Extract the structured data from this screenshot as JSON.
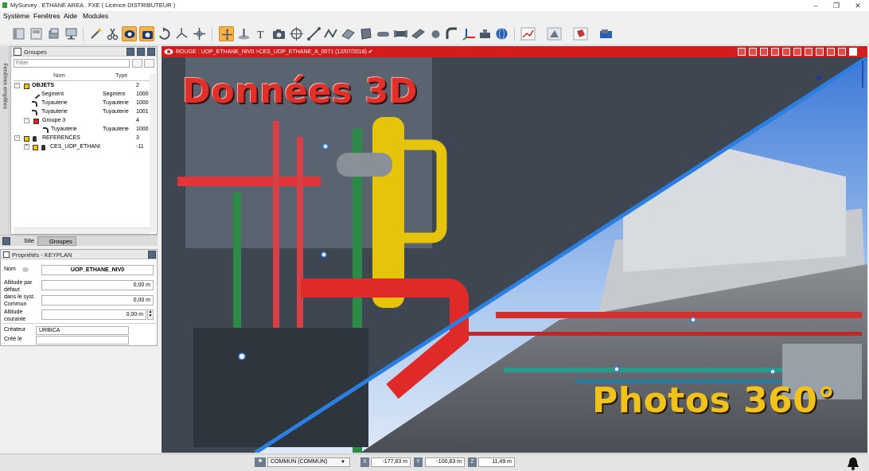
{
  "window": {
    "title": "MySurvey . ETHANE AREA . FXE ( Licence DISTRIBUTEUR )",
    "minimize": "–",
    "maximize": "❐",
    "close": "✕"
  },
  "menu": {
    "items": [
      {
        "label": "Système"
      },
      {
        "label": "Fenêtres"
      },
      {
        "label": "Aide"
      },
      {
        "label": "Modules"
      }
    ]
  },
  "sidebar_tab": {
    "label": "Fenêtres empilées"
  },
  "groups_panel": {
    "title": "Groupes",
    "filter_placeholder": "Filter",
    "columns": {
      "name": "Nom",
      "type": "Type"
    },
    "rows": [
      {
        "name": "OBJETS",
        "type": "",
        "value": "2"
      },
      {
        "name": "Segment",
        "type": "Segment",
        "value": "1000"
      },
      {
        "name": "Tuyauterie",
        "type": "Tuyauterie",
        "value": "1000"
      },
      {
        "name": "Tuyauterie",
        "type": "Tuyauterie",
        "value": "1001"
      },
      {
        "name": "Groupe 3",
        "type": "",
        "value": "4"
      },
      {
        "name": "Tuyauterie",
        "type": "Tuyauterie",
        "value": "1000"
      },
      {
        "name": "REFERENCES",
        "type": "",
        "value": "3"
      },
      {
        "name": "CES_UOP_ETHANI",
        "type": "",
        "value": "-11"
      }
    ],
    "tabs": [
      {
        "label": "Site"
      },
      {
        "label": "Groupes"
      }
    ]
  },
  "properties_panel": {
    "title": "Propriétés - KEYPLAN",
    "nom_label": "Nom",
    "nom_value": "UOP_ETHANE_NIV0",
    "altitude_defaut_label": "Altitude par défaut",
    "altitude_defaut_value": "0,00 m",
    "syst_commun_label": "dans le syst. Commun",
    "syst_commun_value": "0,00 m",
    "altitude_courante_label": "Altitude courante",
    "altitude_courante_value": "0,00 m",
    "createur_label": "Créateur",
    "createur_value": "URBICA",
    "cree_le_label": "Créé le",
    "cree_le_value": ""
  },
  "viewer": {
    "breadcrumb": "ROUGE : UOP_ETHANE_NIV0 >CES_UOP_ETHANE_A_0071 (12/07/2018) ✔",
    "overlay_left": "Données 3D",
    "overlay_right": "Photos 360°",
    "colors": {
      "header": "#d41c1c",
      "label_3d": "#e0302a",
      "label_360": "#f0c21b",
      "divider": "#2a7fe0"
    }
  },
  "statusbar": {
    "system": "COMMUN (COMMUN)",
    "x_label": "X",
    "x_value": "-177,83 m",
    "y_label": "Y",
    "y_value": "-100,83 m",
    "z_label": "Z",
    "z_value": "11,49 m"
  }
}
